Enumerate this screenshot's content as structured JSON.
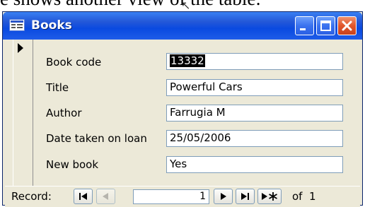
{
  "caption": {
    "text": "e shows another view of the table:"
  },
  "window": {
    "title": "Books",
    "icon": "form-view-icon",
    "buttons": {
      "minimize": "minimize-icon",
      "maximize": "maximize-icon",
      "close": "close-icon"
    }
  },
  "record_selector": {
    "icon": "current-record-arrow-icon"
  },
  "fields": [
    {
      "label": "Book code",
      "value": "13332"
    },
    {
      "label": "Title",
      "value": "Powerful Cars"
    },
    {
      "label": "Author",
      "value": "Farrugia M"
    },
    {
      "label": "Date taken on loan",
      "value": "25/05/2006"
    },
    {
      "label": "New book",
      "value": "Yes"
    }
  ],
  "navigation": {
    "label": "Record:",
    "current": "1",
    "of_text": "of",
    "total": "1",
    "icons": [
      "first-record-icon",
      "previous-record-icon",
      "next-record-icon",
      "last-record-icon",
      "new-record-icon"
    ]
  }
}
